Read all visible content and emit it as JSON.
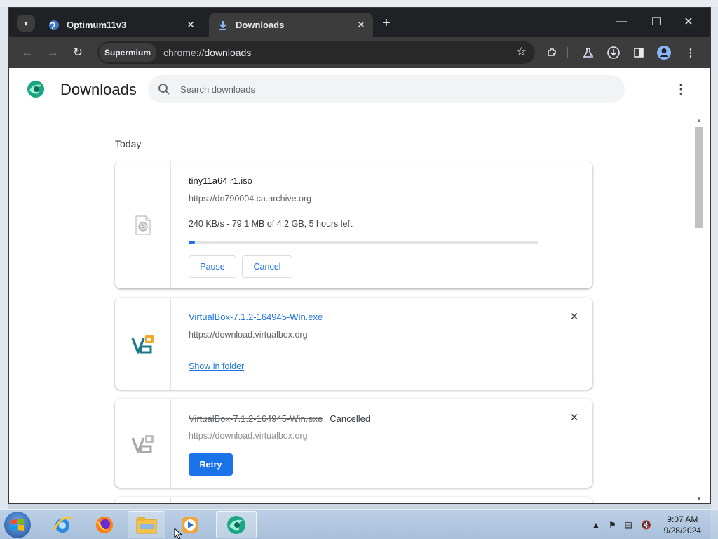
{
  "browser": {
    "tabs": [
      {
        "title": "Optimum11v3",
        "favicon": "globe-icon",
        "active": false
      },
      {
        "title": "Downloads",
        "favicon": "download-icon",
        "active": true
      }
    ],
    "profile_chip": "Supermium",
    "url_scheme": "chrome://",
    "url_host": "downloads"
  },
  "page": {
    "title": "Downloads",
    "search_placeholder": "Search downloads",
    "section_label": "Today"
  },
  "downloads": [
    {
      "filename": "tiny11a64 r1.iso",
      "host": "https://dn790004.ca.archive.org",
      "status": "240 KB/s - 79.1 MB of 4.2 GB, 5 hours left",
      "progress": 0.019,
      "buttons": [
        "Pause",
        "Cancel"
      ],
      "icon": "disc-file-icon"
    },
    {
      "filename": "VirtualBox-7.1.2-164945-Win.exe",
      "host": "https://download.virtualbox.org",
      "action_link": "Show in folder",
      "icon": "virtualbox-icon"
    },
    {
      "filename": "VirtualBox-7.1.2-164945-Win.exe",
      "status": "Cancelled",
      "host": "https://download.virtualbox.org",
      "buttons": [
        "Retry"
      ],
      "icon": "virtualbox-icon"
    }
  ],
  "taskbar": {
    "time": "9:07 AM",
    "date": "9/28/2024"
  },
  "colors": {
    "accent": "#1a73e8",
    "tabstrip": "#202124",
    "toolbar": "#3c3c3c"
  }
}
